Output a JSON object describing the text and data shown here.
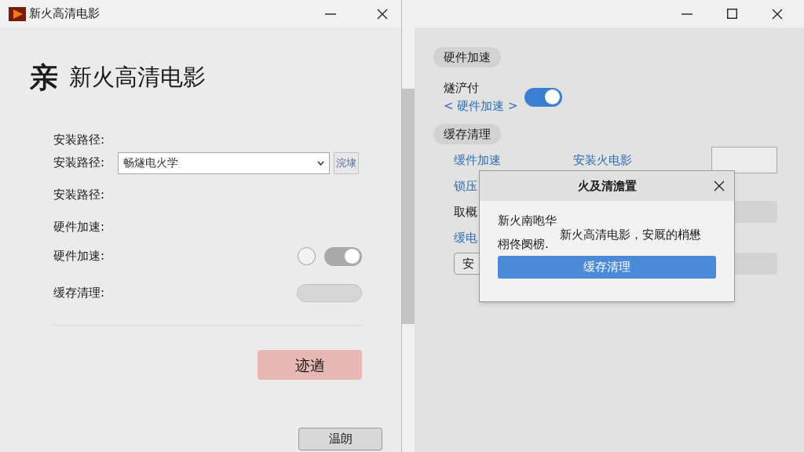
{
  "left_window": {
    "title": "新火高清电影",
    "heading_mark": "亲",
    "heading": "新火高清电影",
    "rows": [
      {
        "kind": "label",
        "label": "安装路径:"
      },
      {
        "kind": "combo",
        "label": "安装路径:",
        "value": "畅燧电火学",
        "button": "浣埭"
      },
      {
        "kind": "label",
        "label": "安装路径:"
      },
      {
        "kind": "label",
        "label": "硬件加速:"
      },
      {
        "kind": "toggle",
        "label": "硬件加速:",
        "radio_selected": false,
        "on": true,
        "disabled": true
      },
      {
        "kind": "pill",
        "label": "缓存清理:"
      }
    ],
    "primary_button": "迹遒",
    "footer_button": "温朗"
  },
  "right_window": {
    "sections": [
      {
        "title": "硬件加速"
      },
      {
        "title": "缓存清理"
      }
    ],
    "toggle_label": "燧浐付",
    "toggle_link": "< 硬件加速 >",
    "toggle_on": true,
    "rows": [
      {
        "kind": "links",
        "link": "缓件加速",
        "text": "安装火电影"
      },
      {
        "kind": "link",
        "link": "锁压"
      },
      {
        "kind": "bar",
        "text": "取概"
      },
      {
        "kind": "link",
        "link": "缓电"
      },
      {
        "kind": "button",
        "text": "安"
      }
    ]
  },
  "dialog": {
    "title": "火及清澹置",
    "lines": [
      "新火南咆华",
      "新火高清电影，安厩的梢懋",
      "栩佟阌椖."
    ],
    "button": "缓存清理"
  }
}
